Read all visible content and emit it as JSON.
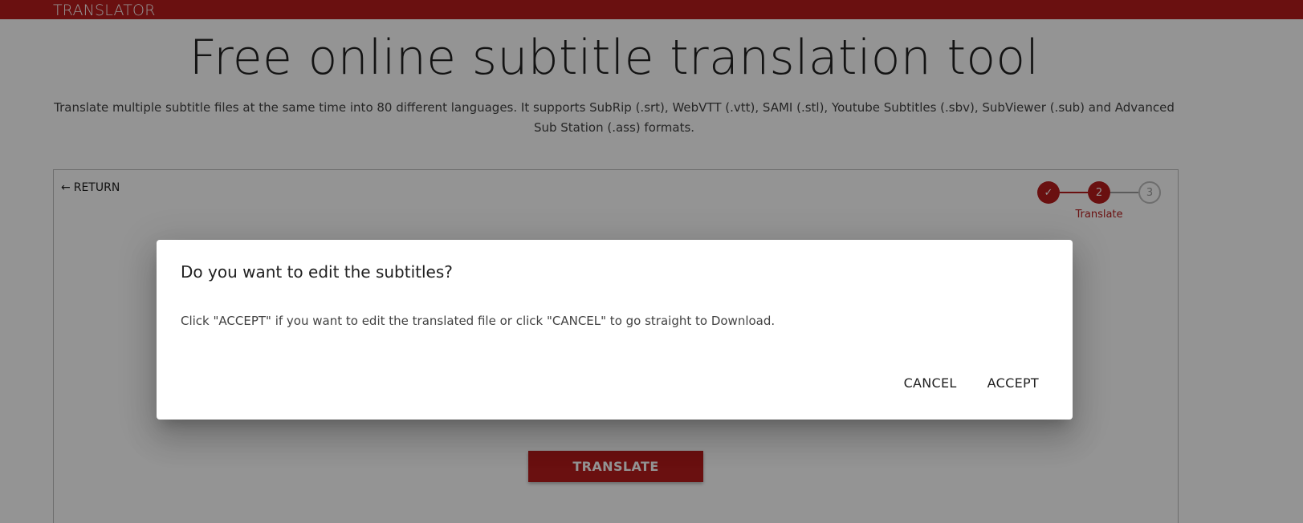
{
  "header": {
    "brand": "TRANSLATOR"
  },
  "hero": {
    "title": "Free online subtitle translation tool",
    "description": "Translate multiple subtitle files at the same time into 80 different languages. It supports SubRip (.srt), WebVTT (.vtt), SAMI (.stl), Youtube Subtitles (.sbv), SubViewer (.sub) and Advanced Sub Station (.ass) formats."
  },
  "card": {
    "return_label": "RETURN",
    "return_icon": "arrow-left-icon",
    "stepper": {
      "steps": [
        {
          "label": "",
          "display": "✓",
          "state": "completed",
          "icon": "check-icon"
        },
        {
          "label": "Translate",
          "display": "2",
          "state": "active"
        },
        {
          "label": "",
          "display": "3",
          "state": "pending"
        }
      ]
    },
    "translate_button": "TRANSLATE"
  },
  "dialog": {
    "title": "Do you want to edit the subtitles?",
    "body": "Click \"ACCEPT\" if you want to edit the translated file or click \"CANCEL\" to go straight to Download.",
    "cancel_label": "CANCEL",
    "accept_label": "ACCEPT"
  },
  "colors": {
    "accent": "#b71c1c",
    "text": "#212121",
    "overlay": "rgba(0,0,0,0.42)"
  }
}
